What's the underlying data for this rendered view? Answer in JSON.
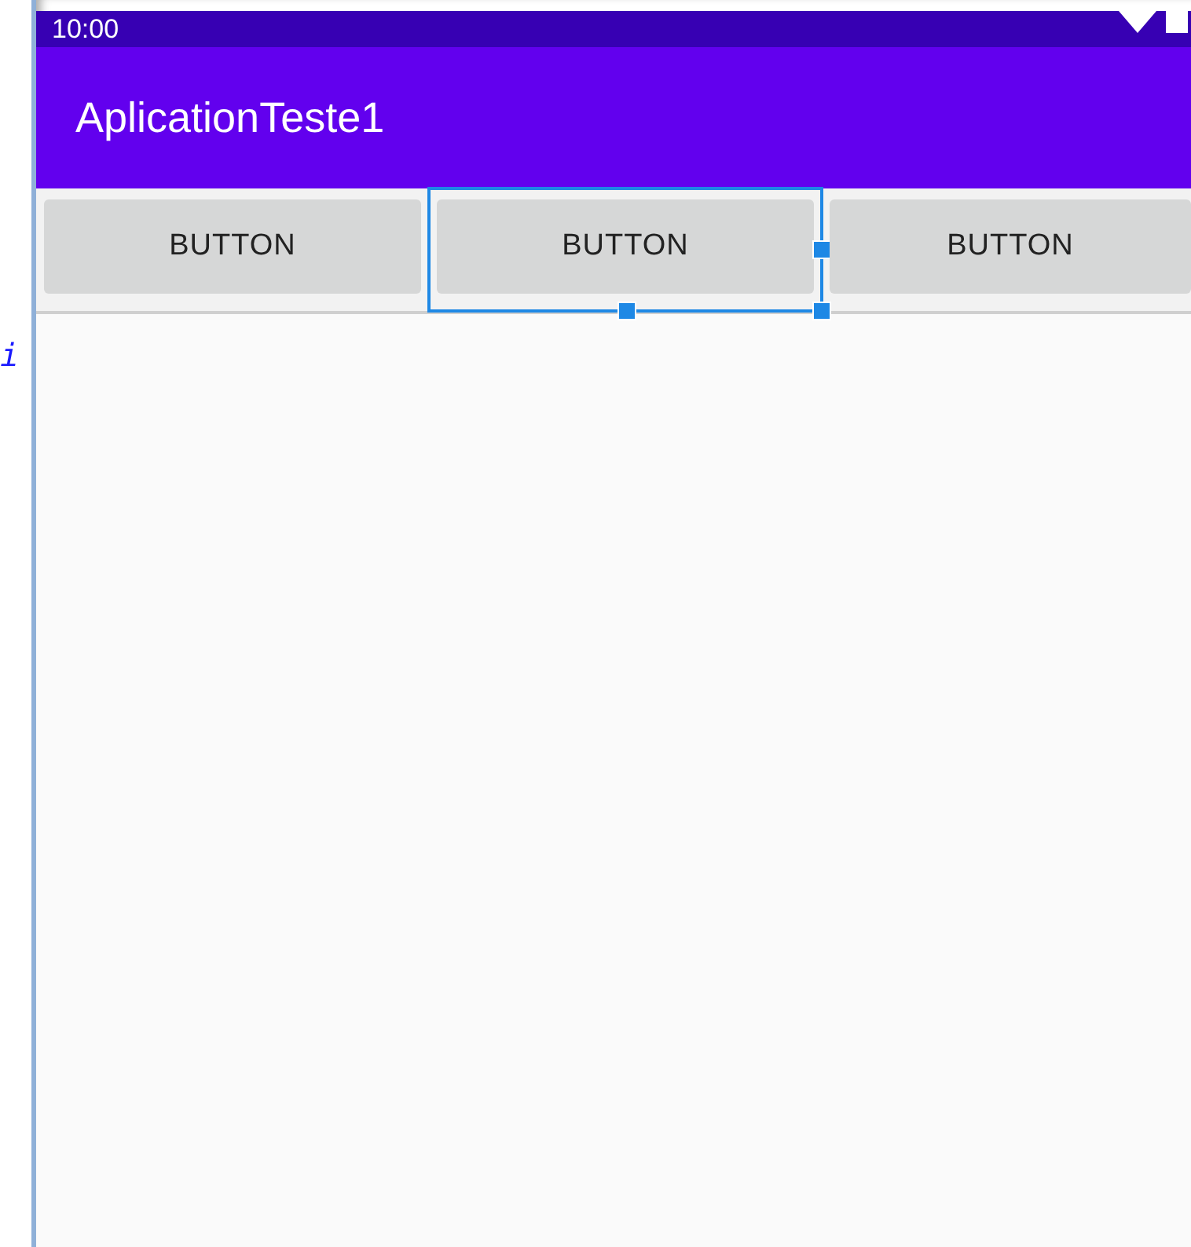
{
  "editor_fragment": "i",
  "status_bar": {
    "time": "10:00"
  },
  "toolbar": {
    "title": "AplicationTeste1"
  },
  "buttons": [
    {
      "label": "BUTTON",
      "selected": false
    },
    {
      "label": "BUTTON",
      "selected": true
    },
    {
      "label": "BUTTON",
      "selected": false
    }
  ]
}
